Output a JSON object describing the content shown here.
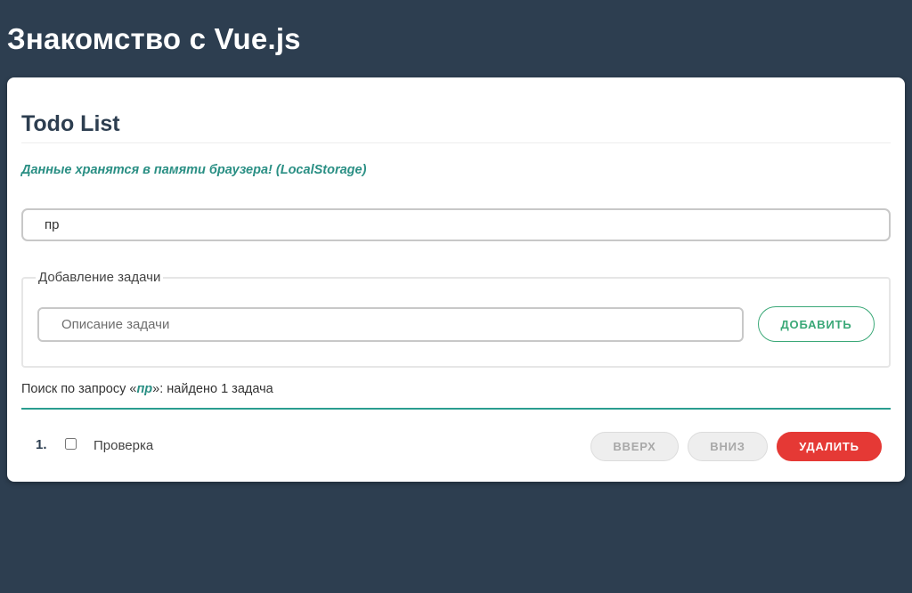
{
  "page": {
    "title": "Знакомство с Vue.js"
  },
  "card": {
    "title": "Todo List",
    "storage_note": "Данные хранятся в памяти браузера! (LocalStorage)"
  },
  "search": {
    "value": "пр"
  },
  "add_task": {
    "legend": "Добавление задачи",
    "placeholder": "Описание задачи",
    "value": "",
    "button_label": "ДОБАВИТЬ"
  },
  "search_result": {
    "prefix": "Поиск по запросу «",
    "query": "пр",
    "suffix": "»: найдено 1 задача"
  },
  "todos": [
    {
      "number": "1.",
      "checked": false,
      "text": "Проверка",
      "up_label": "ВВЕРХ",
      "down_label": "ВНИЗ",
      "delete_label": "УДАЛИТЬ"
    }
  ],
  "colors": {
    "background": "#2d3e50",
    "accent": "#2a8f84",
    "add_button": "#3aa877",
    "delete_button": "#e53935",
    "divider": "#2a9d8f"
  }
}
